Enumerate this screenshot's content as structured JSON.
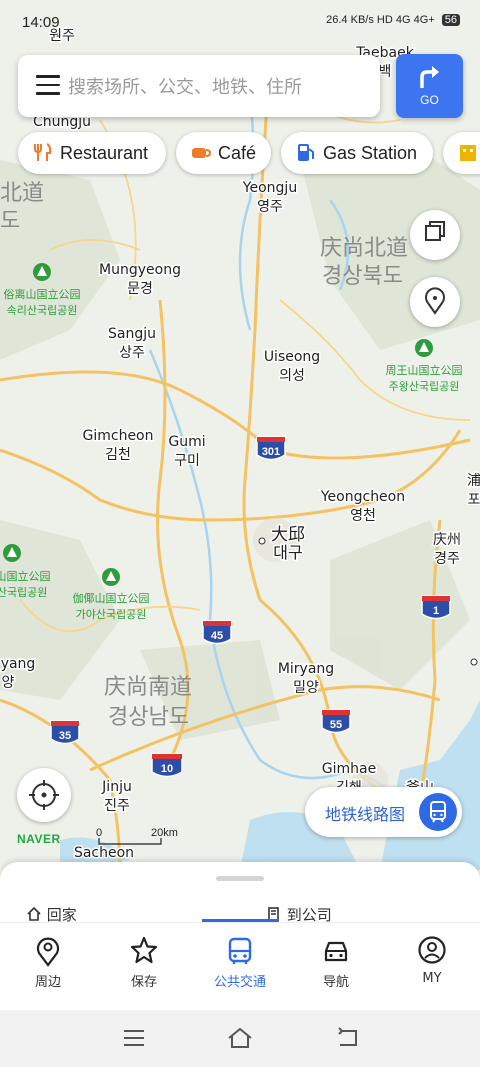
{
  "status": {
    "time": "14:09",
    "net": "26.4 KB/s",
    "signal": "HD 4G 4G+",
    "battery": "56"
  },
  "search": {
    "placeholder": "搜索场所、公交、地铁、住所"
  },
  "go_label": "GO",
  "chips": [
    {
      "label": "Restaurant",
      "icon": "fork-knife-icon",
      "color": "#f07a2b"
    },
    {
      "label": "Café",
      "icon": "coffee-cup-icon",
      "color": "#f07a2b"
    },
    {
      "label": "Gas Station",
      "icon": "gas-pump-icon",
      "color": "#2f6ae6"
    }
  ],
  "map": {
    "places": [
      {
        "name": "Mungyeong",
        "kr": "문경"
      },
      {
        "name": "Yeongju",
        "kr": "영주"
      },
      {
        "name": "Sangju",
        "kr": "상주"
      },
      {
        "name": "Uiseong",
        "kr": "의성"
      },
      {
        "name": "Gimcheon",
        "kr": "김천"
      },
      {
        "name": "Gumi",
        "kr": "구미"
      },
      {
        "name": "Yeongcheon",
        "kr": "영천"
      },
      {
        "name": "大邱",
        "kr": "대구"
      },
      {
        "name": "庆州",
        "kr": "경주"
      },
      {
        "name": "Miryang",
        "kr": "밀양"
      },
      {
        "name": "Jinju",
        "kr": "진주"
      },
      {
        "name": "Gimhae",
        "kr": "김해"
      },
      {
        "name": "Sacheon",
        "kr": ""
      },
      {
        "name": "Taebaek",
        "kr": "백"
      },
      {
        "name": "Chungju",
        "kr": ""
      },
      {
        "name": "yang",
        "kr": "양"
      },
      {
        "name": "浦",
        "kr": "포"
      },
      {
        "name": "釜山",
        "kr": ""
      },
      {
        "name": "원주",
        "kr": ""
      }
    ],
    "regions": [
      {
        "name": "庆尚北道",
        "kr": "경상북도"
      },
      {
        "name": "庆尚南道",
        "kr": "경상남도"
      },
      {
        "name": "北道",
        "kr": "도"
      }
    ],
    "parks": [
      {
        "name": "俗离山国立公园",
        "kr": "속리산국립공원"
      },
      {
        "name": "周王山国立公园",
        "kr": "주왕산국립공원"
      },
      {
        "name": "伽倻山国立公园",
        "kr": "가야산국립공원"
      },
      {
        "name": "智异山国立公园",
        "kr": "지리산국립공원"
      }
    ],
    "shields": [
      "301",
      "45",
      "1",
      "55",
      "35",
      "10"
    ],
    "scale": {
      "zero": "0",
      "end": "20km"
    }
  },
  "naver_logo": "NAVER",
  "subway_button": "地铁线路图",
  "quick_links": {
    "home": "回家",
    "work": "到公司"
  },
  "tabs": [
    {
      "label": "周边",
      "icon": "map-pin-icon"
    },
    {
      "label": "保存",
      "icon": "star-icon"
    },
    {
      "label": "公共交通",
      "icon": "bus-icon"
    },
    {
      "label": "导航",
      "icon": "car-icon"
    },
    {
      "label": "MY",
      "icon": "user-icon"
    }
  ],
  "active_tab": "公共交通",
  "colors": {
    "accent": "#2f6ae6",
    "go": "#3d74f0",
    "park": "#2e9b3d",
    "highway": "#f0b43c"
  }
}
